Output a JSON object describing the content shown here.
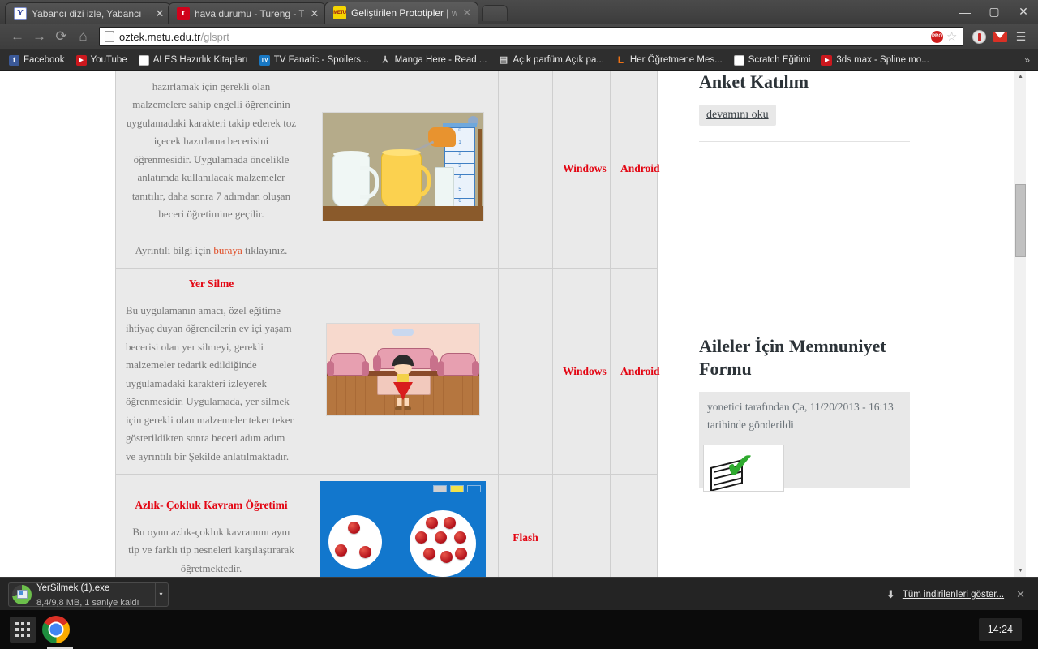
{
  "browser": {
    "tabs": [
      {
        "title": "Yabancı dizi izle, Yabancı ",
        "favicon": "yahoo-favicon",
        "active": false
      },
      {
        "title": "hava durumu - Tureng - T",
        "favicon": "tureng-favicon",
        "active": false
      },
      {
        "title": "Geliştirilen Prototipler | ",
        "title_dim": "ww",
        "favicon": "metu-favicon",
        "active": true
      }
    ],
    "window_controls": {
      "minimize": "—",
      "maximize": "▢",
      "close": "✕"
    },
    "nav": {
      "back": "←",
      "forward": "→",
      "reload": "⟳",
      "home": "⌂"
    },
    "omnibox": {
      "url_host": "oztek.metu.edu.tr",
      "url_path": "/glsprt",
      "pro_badge": "PRO",
      "bookmark_star": "☆"
    },
    "extensions": [
      {
        "name": "adblock-icon"
      },
      {
        "name": "gmail-icon"
      }
    ],
    "menu_icon": "☰",
    "bookmarks": [
      {
        "label": "Facebook",
        "icon": "facebook-icon",
        "glyph": "f"
      },
      {
        "label": "YouTube",
        "icon": "youtube-icon",
        "glyph": "▶"
      },
      {
        "label": "ALES Hazırlık Kitapları",
        "icon": "document-icon",
        "glyph": ""
      },
      {
        "label": "TV Fanatic - Spoilers...",
        "icon": "tv-icon",
        "glyph": "TV"
      },
      {
        "label": "Manga Here - Read ...",
        "icon": "manga-icon",
        "glyph": "⅄"
      },
      {
        "label": "Açık parfüm,Açık pa...",
        "icon": "cart-icon",
        "glyph": "🛒"
      },
      {
        "label": "Her Öğretmene Mes...",
        "icon": "orange-L-icon",
        "glyph": "L"
      },
      {
        "label": "Scratch Eğitimi",
        "icon": "document-icon",
        "glyph": ""
      },
      {
        "label": "3ds max - Spline mo...",
        "icon": "youtube-icon",
        "glyph": "▶"
      }
    ],
    "bookmarks_overflow": "»"
  },
  "page": {
    "table": {
      "rows": [
        {
          "title": "",
          "description": "hazırlamak için gerekli olan malzemelere sahip engelli öğrencinin uygulamadaki karakteri takip ederek toz içecek hazırlama becerisini öğrenmesidir. Uygulamada öncelikle anlatımda kullanılacak malzemeler tanıtılır, daha sonra 7 adımdan oluşan beceri öğretimine geçilir.",
          "link_prefix": "Ayrıntılı bilgi için ",
          "link_text": "buraya",
          "link_suffix": " tıklayınız.",
          "image_name": "toz-icecek-hazirlama-illustration",
          "flash": "",
          "windows": "Windows",
          "android": "Android",
          "align": "center"
        },
        {
          "title": "Yer Silme",
          "description": "Bu uygulamanın amacı, özel eğitime ihtiyaç duyan öğrencilerin ev içi yaşam becerisi olan yer silmeyi, gerekli malzemeler tedarik edildiğinde uygulamadaki karakteri izleyerek öğrenmesidir. Uygulamada, yer silmek için gerekli olan malzemeler teker teker gösterildikten sonra beceri adım adım ve ayrıntılı bir Şekilde anlatılmaktadır.",
          "image_name": "yer-silme-illustration",
          "flash": "",
          "windows": "Windows",
          "android": "Android",
          "align": "left"
        },
        {
          "title": "Azlık- Çokluk Kavram Öğretimi",
          "description": "Bu oyun azlık-çokluk kavramını aynı tip ve farklı tip nesneleri karşılaştırarak öğretmektedir.",
          "image_name": "azlik-cokluk-illustration",
          "flash": "Flash",
          "windows": "",
          "android": "",
          "align": "center"
        }
      ]
    },
    "sidebar": {
      "anket": {
        "heading": "Anket Katılım",
        "read_more": "devamını oku"
      },
      "memnuniyet": {
        "heading": "Aileler İçin Memnuniyet Formu",
        "submitted": "yonetici tarafından Ça, 11/20/2013 - 16:13 tarihinde gönderildi",
        "thumb_name": "checklist-check-icon"
      }
    },
    "scrollbar": {
      "up": "▲",
      "down": "▼"
    }
  },
  "download_shelf": {
    "item": {
      "filename": "YerSilmek (1).exe",
      "status": "8,4/9,8 MB, 1 saniye kaldı",
      "caret": "▾"
    },
    "show_all_label": "Tüm indirilenleri göster...",
    "show_all_arrow": "⬇",
    "close": "✕"
  },
  "taskbar": {
    "apps_icon": "apps-grid-icon",
    "chrome_icon": "chrome-icon",
    "clock": "14:24"
  },
  "colors": {
    "accent_red": "#e30613",
    "link_orange": "#e04a22",
    "table_cell_bg": "#eaeaea",
    "sidebar_block_bg": "#e8e8e8"
  }
}
